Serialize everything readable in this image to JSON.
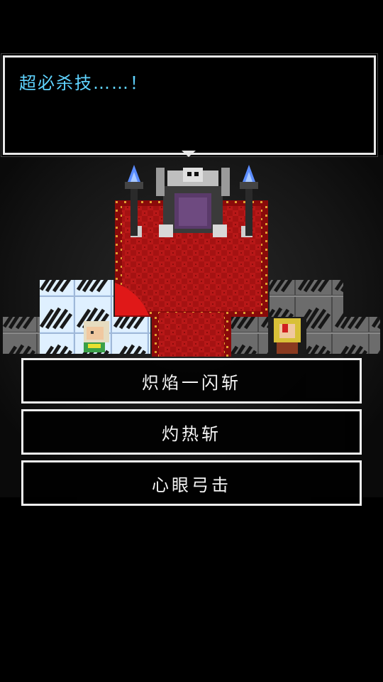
{
  "dialog": {
    "text": "超必杀技……！"
  },
  "choices": [
    {
      "label": "炽焰一闪斩"
    },
    {
      "label": "灼热斩"
    },
    {
      "label": "心眼弓击"
    }
  ],
  "colors": {
    "dialog_text": "#5fd3ff",
    "border": "#f0f0f0",
    "carpet": "#b01414",
    "carpet_trim": "#e0a030",
    "flame": "#5b8cff"
  }
}
